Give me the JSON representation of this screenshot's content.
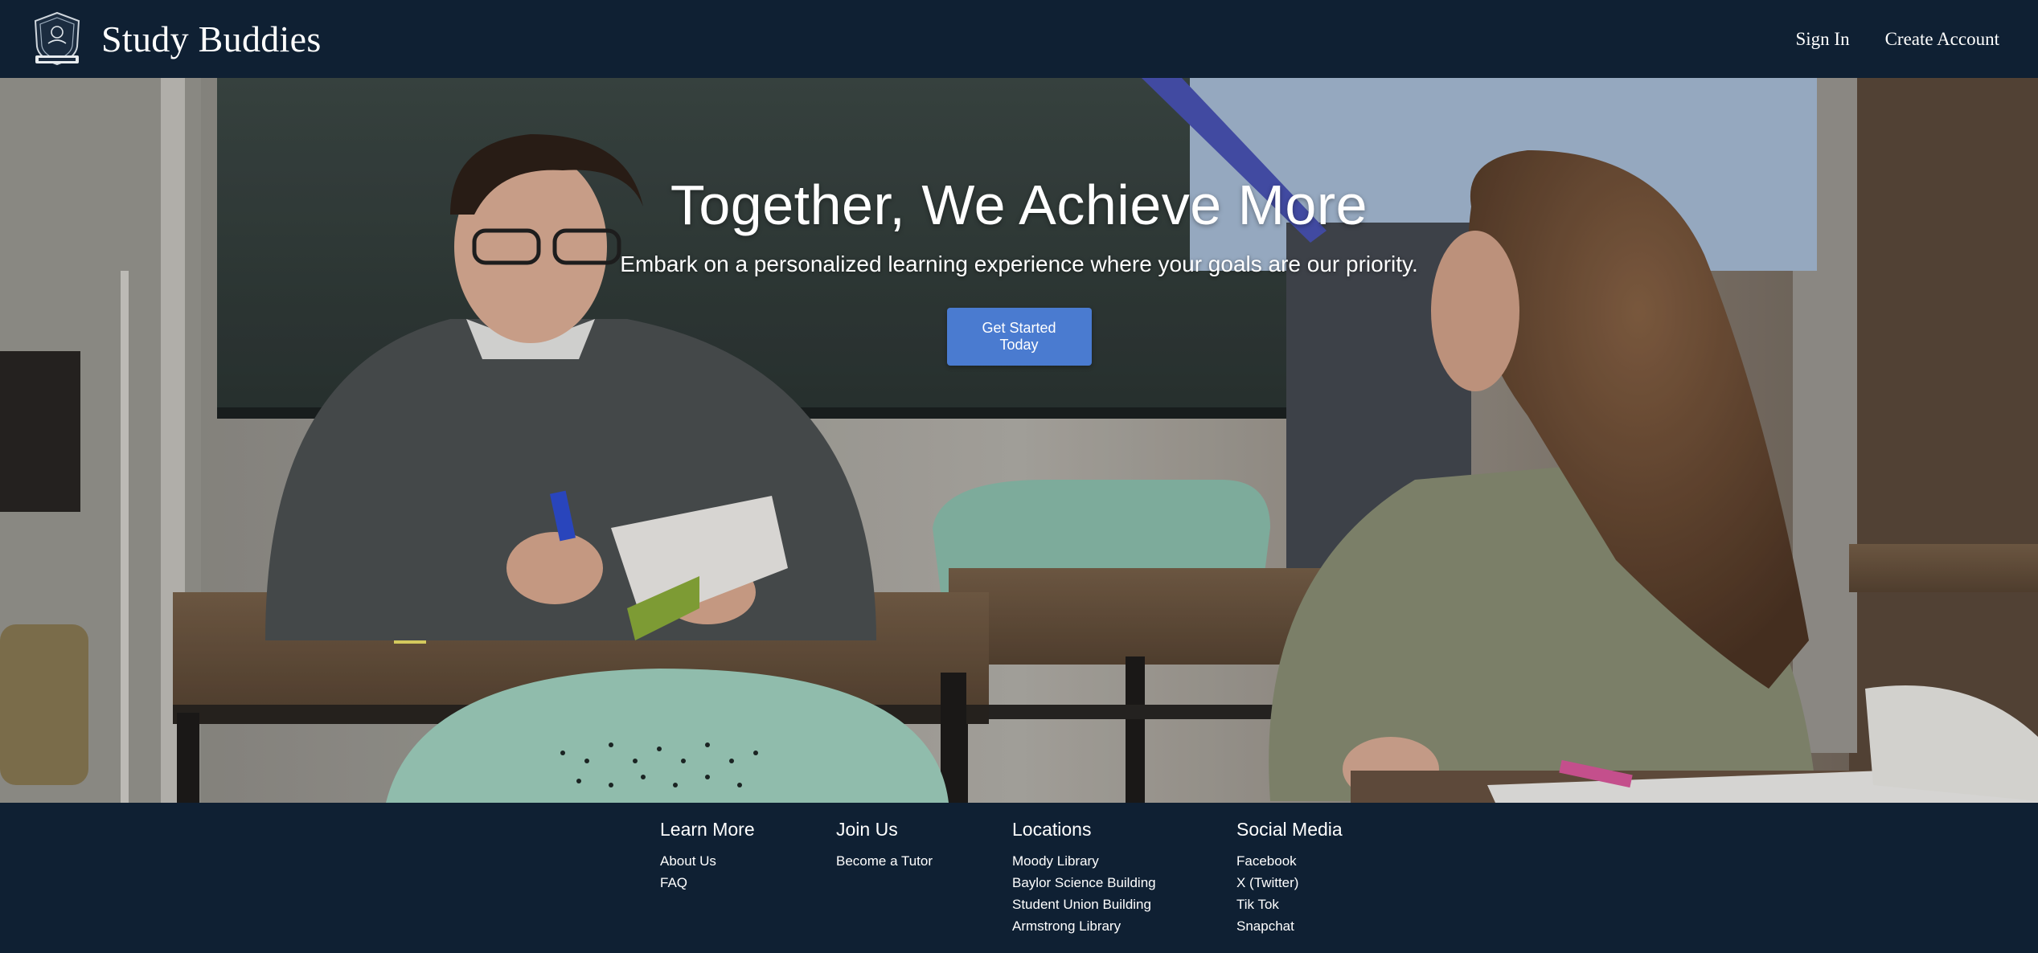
{
  "header": {
    "brand_name": "Study Buddies",
    "nav": {
      "sign_in": "Sign In",
      "create_account": "Create Account"
    }
  },
  "hero": {
    "title": "Together, We Achieve More",
    "subtitle": "Embark on a personalized learning experience where your goals are our priority.",
    "cta_label": "Get Started Today"
  },
  "footer": {
    "learn_more": {
      "heading": "Learn More",
      "links": [
        "About Us",
        "FAQ"
      ]
    },
    "join_us": {
      "heading": "Join Us",
      "links": [
        "Become a Tutor"
      ]
    },
    "locations": {
      "heading": "Locations",
      "links": [
        "Moody Library",
        "Baylor Science Building",
        "Student Union Building",
        "Armstrong Library"
      ]
    },
    "social_media": {
      "heading": "Social Media",
      "links": [
        "Facebook",
        "X (Twitter)",
        "Tik Tok",
        "Snapchat"
      ]
    }
  },
  "colors": {
    "navbar_bg": "#0f2033",
    "cta_bg": "#4a7bd0",
    "text": "#ffffff"
  }
}
